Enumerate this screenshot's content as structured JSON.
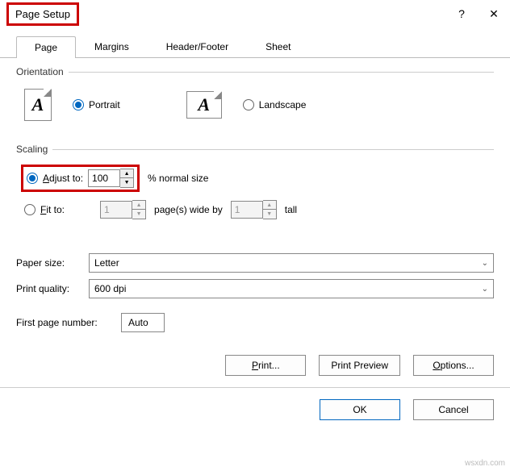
{
  "window": {
    "title": "Page Setup",
    "help": "?",
    "close": "✕"
  },
  "tabs": [
    "Page",
    "Margins",
    "Header/Footer",
    "Sheet"
  ],
  "orientation": {
    "legend": "Orientation",
    "portrait": "Portrait",
    "landscape": "Landscape",
    "icon_letter": "A"
  },
  "scaling": {
    "legend": "Scaling",
    "adjust_label_pre": "A",
    "adjust_label_post": "djust to:",
    "adjust_value": "100",
    "adjust_suffix": "% normal size",
    "fit_label_pre": "F",
    "fit_label_post": "it to:",
    "fit_wide": "1",
    "fit_mid": "page(s) wide by",
    "fit_tall": "1",
    "fit_suffix": "tall"
  },
  "paper": {
    "size_label": "Paper size:",
    "size_value": "Letter",
    "quality_label": "Print quality:",
    "quality_value": "600 dpi"
  },
  "firstpage": {
    "label": "First page number:",
    "value": "Auto"
  },
  "buttons": {
    "print": "Print...",
    "preview": "Print Preview",
    "options": "Options...",
    "ok": "OK",
    "cancel": "Cancel"
  },
  "watermark": "wsxdn.com"
}
